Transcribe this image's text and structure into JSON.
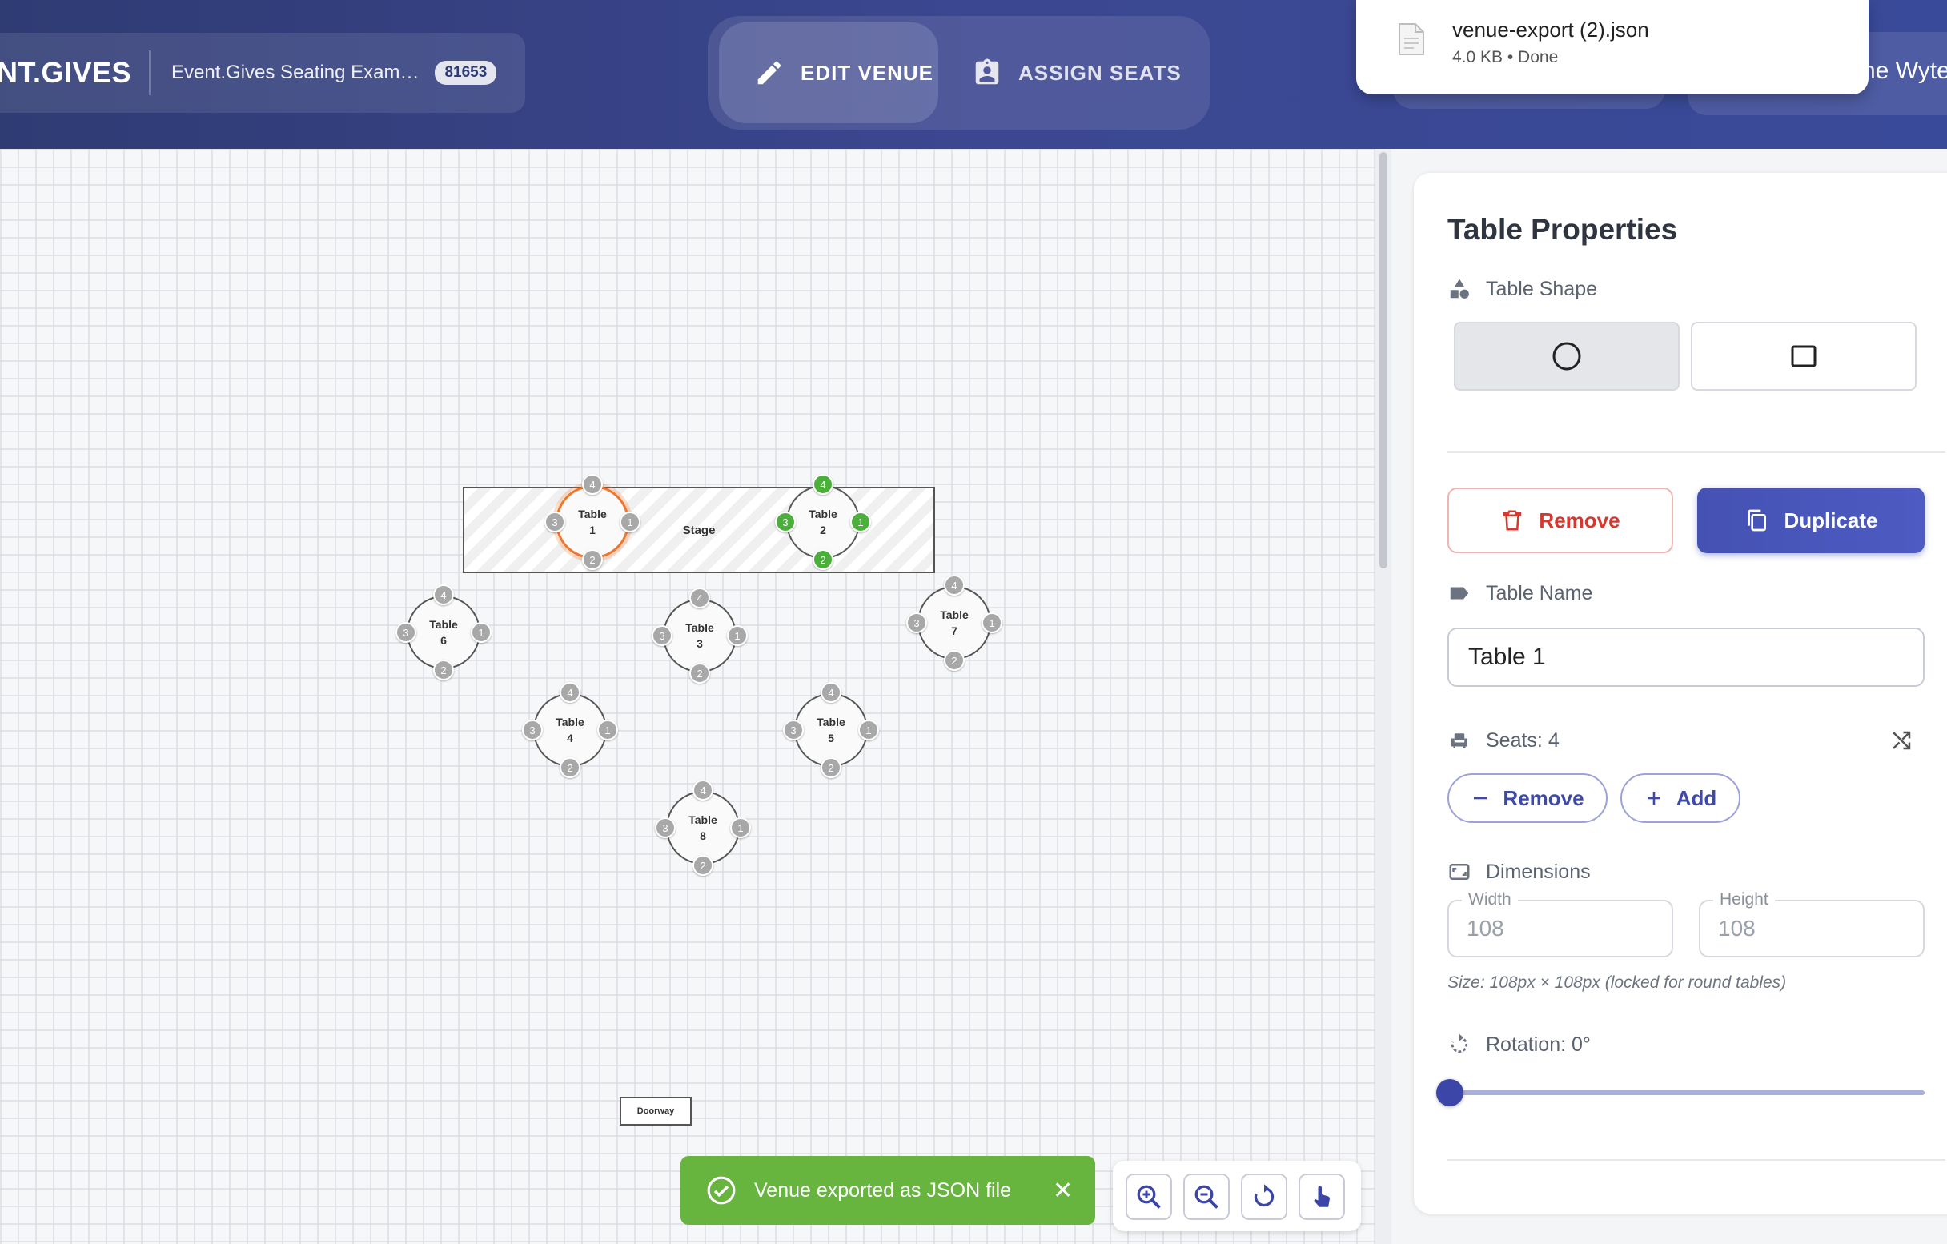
{
  "header": {
    "brand": "NT.GIVES",
    "event_name": "Event.Gives Seating Exam…",
    "event_id": "81653",
    "mode_edit": "EDIT VENUE",
    "mode_assign": "ASSIGN SEATS",
    "user_name_partial": "ne Wyte"
  },
  "download": {
    "file_name": "venue-export (2).json",
    "file_meta": "4.0 KB • Done"
  },
  "canvas": {
    "stage_label": "Stage",
    "doorway_label": "Doorway",
    "tables": [
      {
        "name": "Table",
        "number": "1",
        "selected": true,
        "seats": [
          "4",
          "1",
          "2",
          "3"
        ],
        "seat_status": [
          "empty",
          "empty",
          "empty",
          "empty"
        ]
      },
      {
        "name": "Table",
        "number": "2",
        "selected": false,
        "seats": [
          "4",
          "1",
          "2",
          "3"
        ],
        "seat_status": [
          "assigned",
          "assigned",
          "assigned",
          "assigned"
        ]
      },
      {
        "name": "Table",
        "number": "3",
        "selected": false,
        "seats": [
          "4",
          "1",
          "2",
          "3"
        ],
        "seat_status": [
          "empty",
          "empty",
          "empty",
          "empty"
        ]
      },
      {
        "name": "Table",
        "number": "4",
        "selected": false,
        "seats": [
          "4",
          "1",
          "2",
          "3"
        ],
        "seat_status": [
          "empty",
          "empty",
          "empty",
          "empty"
        ]
      },
      {
        "name": "Table",
        "number": "5",
        "selected": false,
        "seats": [
          "4",
          "1",
          "2",
          "3"
        ],
        "seat_status": [
          "empty",
          "empty",
          "empty",
          "empty"
        ]
      },
      {
        "name": "Table",
        "number": "6",
        "selected": false,
        "seats": [
          "4",
          "1",
          "2",
          "3"
        ],
        "seat_status": [
          "empty",
          "empty",
          "empty",
          "empty"
        ]
      },
      {
        "name": "Table",
        "number": "7",
        "selected": false,
        "seats": [
          "4",
          "1",
          "2",
          "3"
        ],
        "seat_status": [
          "empty",
          "empty",
          "empty",
          "empty"
        ]
      },
      {
        "name": "Table",
        "number": "8",
        "selected": false,
        "seats": [
          "4",
          "1",
          "2",
          "3"
        ],
        "seat_status": [
          "empty",
          "empty",
          "empty",
          "empty"
        ]
      }
    ]
  },
  "toast": {
    "message": "Venue exported as JSON file",
    "close": "✕"
  },
  "zoom_controls": [
    "zoom-in-icon",
    "zoom-out-icon",
    "reset-icon",
    "pan-hand-icon"
  ],
  "panel": {
    "title": "Table Properties",
    "shape_label": "Table Shape",
    "shape_options": [
      "round",
      "square"
    ],
    "shape_selected": "round",
    "remove_label": "Remove",
    "duplicate_label": "Duplicate",
    "name_label": "Table Name",
    "name_value": "Table 1",
    "seats_label": "Seats: 4",
    "seat_remove_label": "Remove",
    "seat_add_label": "Add",
    "dimensions_label": "Dimensions",
    "width_label": "Width",
    "width_value": "108",
    "height_label": "Height",
    "height_value": "108",
    "size_note": "Size: 108px × 108px (locked for round tables)",
    "rotation_label": "Rotation: 0°",
    "rotation_value": 0
  },
  "colors": {
    "header": "#3b4790",
    "accent": "#4552b3",
    "danger": "#d6372e",
    "seat_assigned": "#4caf3c",
    "seat_empty": "#a8a8a8",
    "selection": "#f0762d",
    "toast": "#67b43e"
  }
}
